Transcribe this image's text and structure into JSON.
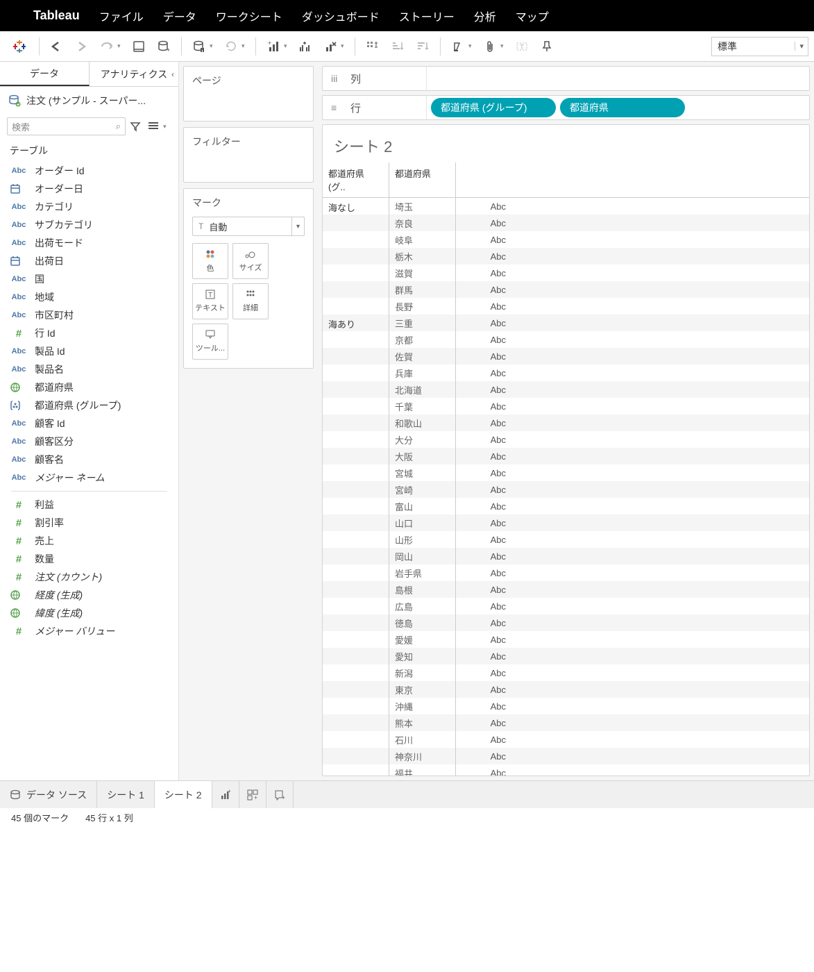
{
  "mac_menu": {
    "app": "Tableau",
    "items": [
      "ファイル",
      "データ",
      "ワークシート",
      "ダッシュボード",
      "ストーリー",
      "分析",
      "マップ"
    ]
  },
  "toolbar": {
    "fit": "標準"
  },
  "side": {
    "tabs": {
      "data": "データ",
      "analytics": "アナリティクス"
    },
    "datasource": "注文 (サンプル - スーパー...",
    "search_placeholder": "検索",
    "tables_header": "テーブル",
    "fields": [
      {
        "icon": "abc",
        "label": "オーダー Id"
      },
      {
        "icon": "date",
        "label": "オーダー日"
      },
      {
        "icon": "abc",
        "label": "カテゴリ"
      },
      {
        "icon": "abc",
        "label": "サブカテゴリ"
      },
      {
        "icon": "abc",
        "label": "出荷モード"
      },
      {
        "icon": "date",
        "label": "出荷日"
      },
      {
        "icon": "abc",
        "label": "国"
      },
      {
        "icon": "abc",
        "label": "地域"
      },
      {
        "icon": "abc",
        "label": "市区町村"
      },
      {
        "icon": "num",
        "label": "行 Id"
      },
      {
        "icon": "abc",
        "label": "製品 Id"
      },
      {
        "icon": "abc",
        "label": "製品名"
      },
      {
        "icon": "geo",
        "label": "都道府県"
      },
      {
        "icon": "grp",
        "label": "都道府県 (グループ)"
      },
      {
        "icon": "abc",
        "label": "顧客 Id"
      },
      {
        "icon": "abc",
        "label": "顧客区分"
      },
      {
        "icon": "abc",
        "label": "顧客名"
      },
      {
        "icon": "abc",
        "label": "メジャー ネーム",
        "meas": true
      }
    ],
    "measures": [
      {
        "icon": "num",
        "label": "利益"
      },
      {
        "icon": "num",
        "label": "割引率"
      },
      {
        "icon": "num",
        "label": "売上"
      },
      {
        "icon": "num",
        "label": "数量"
      },
      {
        "icon": "num",
        "label": "注文 (カウント)",
        "meas": true
      },
      {
        "icon": "geo",
        "label": "経度 (生成)",
        "meas": true
      },
      {
        "icon": "geo",
        "label": "緯度 (生成)",
        "meas": true
      },
      {
        "icon": "num",
        "label": "メジャー バリュー",
        "meas": true
      }
    ]
  },
  "cards": {
    "pages": "ページ",
    "filters": "フィルター",
    "marks": "マーク",
    "mark_type": "自動",
    "mark_buttons": [
      "色",
      "サイズ",
      "テキスト",
      "詳細",
      "ツール..."
    ]
  },
  "shelves": {
    "columns": "列",
    "rows": "行",
    "row_pills": [
      "都道府県 (グループ)",
      "都道府県"
    ]
  },
  "viz": {
    "title": "シート 2",
    "headers": [
      "都道府県 (グ..",
      "都道府県"
    ],
    "abc": "Abc",
    "groups": [
      {
        "name": "海なし",
        "rows": [
          "埼玉",
          "奈良",
          "岐阜",
          "栃木",
          "滋賀",
          "群馬",
          "長野"
        ]
      },
      {
        "name": "海あり",
        "rows": [
          "三重",
          "京都",
          "佐賀",
          "兵庫",
          "北海道",
          "千葉",
          "和歌山",
          "大分",
          "大阪",
          "宮城",
          "宮崎",
          "富山",
          "山口",
          "山形",
          "岡山",
          "岩手県",
          "島根",
          "広島",
          "徳島",
          "愛媛",
          "愛知",
          "新潟",
          "東京",
          "沖縄",
          "熊本",
          "石川",
          "神奈川",
          "福井"
        ]
      }
    ]
  },
  "bottom": {
    "datasource": "データ ソース",
    "sheets": [
      "シート 1",
      "シート 2"
    ]
  },
  "status": {
    "marks": "45 個のマーク",
    "rowscols": "45 行 x 1 列"
  }
}
